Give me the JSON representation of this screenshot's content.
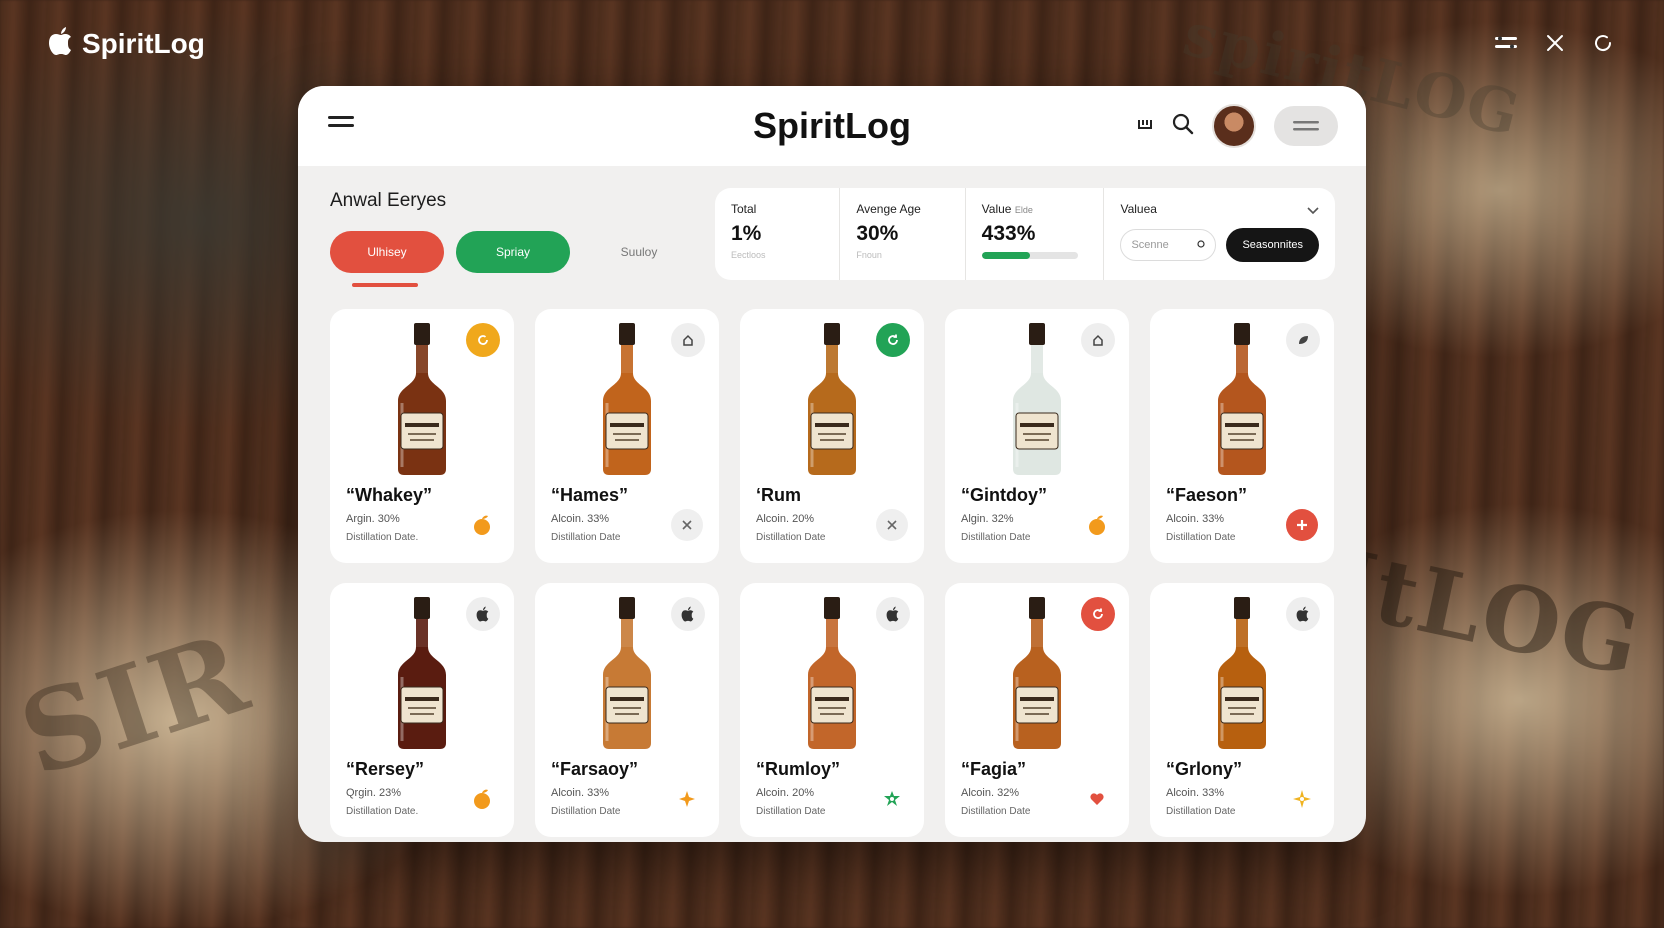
{
  "app": {
    "name": "SpiritLog"
  },
  "window": {
    "title": "SpiritLog"
  },
  "section": {
    "title": "Anwal Eeryes"
  },
  "filters": [
    {
      "label": "Ulhisey",
      "color": "#e2503f",
      "active": true
    },
    {
      "label": "Spriay",
      "color": "#22a356"
    },
    {
      "label": "Suuloy"
    }
  ],
  "stats": [
    {
      "label": "Total",
      "value": "1%",
      "sub": "Eectloos"
    },
    {
      "label": "Avenge Age",
      "value": "30%",
      "sub": "Fnoun"
    },
    {
      "label": "Value",
      "label_extra": "Elde",
      "value": "433%",
      "progress": 0.5
    }
  ],
  "value_filter": {
    "label": "Valuea",
    "search_placeholder": "Scenne",
    "button": "Seasonnites"
  },
  "cards": [
    {
      "name": "“Whakey”",
      "alc": "Argin. 30%",
      "date": "Distillation Date.",
      "corner": "circle-arrow-icon",
      "corner_color": "#f0a81c",
      "action": "orange-fruit-icon",
      "liquid": "#7a3212"
    },
    {
      "name": "“Hames”",
      "alc": "Alcoin. 33%",
      "date": "Distillation Date",
      "corner": "home-icon",
      "action": "close-icon",
      "liquid": "#c1641c"
    },
    {
      "name": "‘Rum",
      "alc": "Alcoin. 20%",
      "date": "Distillation Date",
      "corner": "refresh-icon",
      "corner_color": "#22a356",
      "action": "close-icon",
      "liquid": "#b66a1c"
    },
    {
      "name": "“Gintdoy”",
      "alc": "Algin. 32%",
      "date": "Distillation Date",
      "corner": "home-icon",
      "action": "orange-fruit-icon",
      "liquid": "#dfe7e2"
    },
    {
      "name": "“Faeson”",
      "alc": "Alcoin. 33%",
      "date": "Distillation Date",
      "corner": "leaf-icon",
      "action": "plus-icon",
      "liquid": "#b4561e"
    },
    {
      "name": "“Rersey”",
      "alc": "Qrgin. 23%",
      "date": "Distillation Date.",
      "corner": "apple-icon",
      "action": "orange-fruit-icon",
      "liquid": "#5a1c10"
    },
    {
      "name": "“Farsaoy”",
      "alc": "Alcoin. 33%",
      "date": "Distillation Date",
      "corner": "apple-icon",
      "action": "star-icon",
      "liquid": "#c77a35"
    },
    {
      "name": "“Rumloy”",
      "alc": "Alcoin. 20%",
      "date": "Distillation Date",
      "corner": "apple-icon",
      "action": "flower-icon",
      "liquid": "#c2662a"
    },
    {
      "name": "“Fagia”",
      "alc": "Alcoin. 32%",
      "date": "Distillation Date",
      "corner": "refresh-icon",
      "corner_color": "#e2503f",
      "action": "heart-icon",
      "liquid": "#b8611f"
    },
    {
      "name": "“Grlony”",
      "alc": "Alcoin. 33%",
      "date": "Distillation Date",
      "corner": "apple-icon",
      "action": "sparkle-icon",
      "liquid": "#b7600f"
    }
  ],
  "colors": {
    "accent_red": "#e2503f",
    "accent_green": "#22a356",
    "accent_orange": "#f0a81c",
    "dark": "#151515"
  }
}
